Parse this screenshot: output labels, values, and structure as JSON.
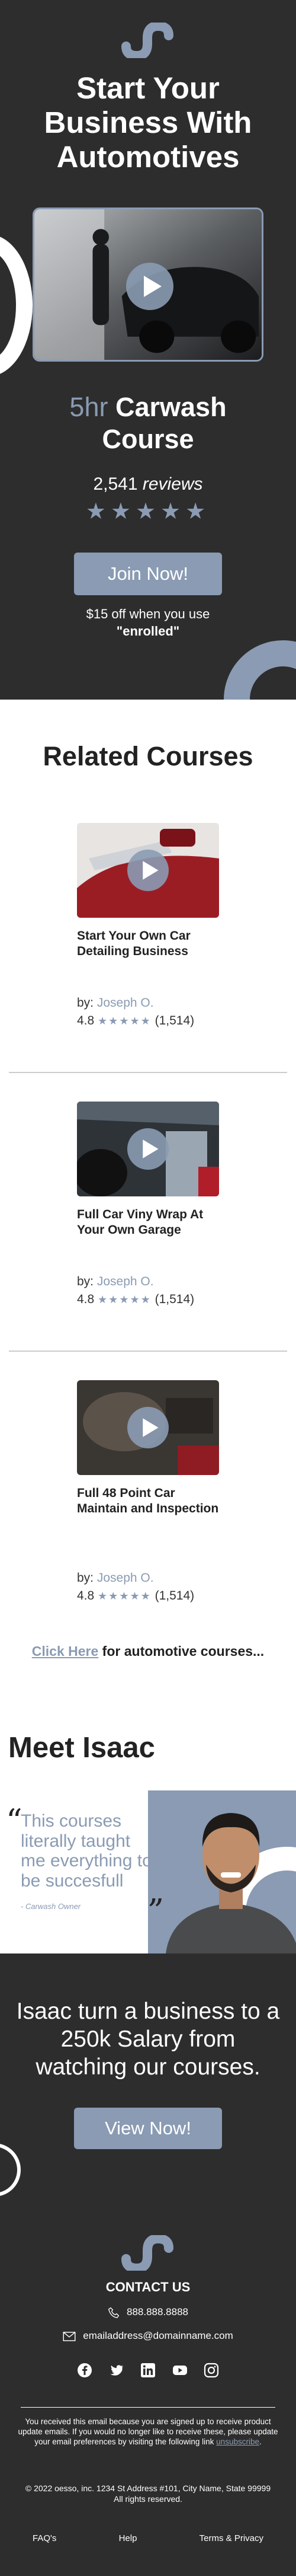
{
  "hero": {
    "title": "Start Your Business With Automotives",
    "course_hours": "5hr",
    "course_name": "Carwash Course",
    "reviews_count": "2,541",
    "reviews_word": "reviews",
    "rating_stars": 5,
    "stars_text": "★★★★★",
    "cta_label": "Join Now!",
    "offer_line1": "$15 off when you use",
    "offer_line2": "\"enrolled\""
  },
  "related": {
    "heading": "Related Courses",
    "by_label": "by:",
    "courses": [
      {
        "title": "Start Your Own Car Detailing Business",
        "author": "Joseph O.",
        "rating": "4.8",
        "stars": "★★★★★",
        "count": "(1,514)"
      },
      {
        "title": "Full Car Viny Wrap At Your Own Garage",
        "author": "Joseph O.",
        "rating": "4.8",
        "stars": "★★★★★",
        "count": "(1,514)"
      },
      {
        "title": "Full 48 Point Car Maintain and Inspection",
        "author": "Joseph O.",
        "rating": "4.8",
        "stars": "★★★★★",
        "count": "(1,514)"
      }
    ],
    "more_link": "Click Here",
    "more_text": " for automotive courses..."
  },
  "meet": {
    "heading": "Meet Isaac",
    "quote": "This courses literally taught me everything to be succesfull",
    "quote_open": "“",
    "quote_close": "„",
    "cite": "- Carwash Owner"
  },
  "testimonial": {
    "text": "Isaac turn a business to a 250k Salary from watching our courses.",
    "cta_label": "View Now!"
  },
  "footer": {
    "contact_heading": "CONTACT US",
    "phone": "888.888.8888",
    "email": "emailaddress@domainname.com",
    "socials": [
      "facebook-icon",
      "twitter-icon",
      "linkedin-icon",
      "youtube-icon",
      "instagram-icon"
    ],
    "disclaimer": "You received this email because you are signed up to receive product update emails. If you would no longer like to receive these, please update your email preferences by visiting the following link ",
    "unsubscribe": "unsubscribe",
    "disclaimer_end": ".",
    "address": "© 2022 oesso, inc. 1234 St Address #101, City Name, State 99999",
    "rights": "All rights reserved.",
    "links": [
      "FAQ's",
      "Help",
      "Terms & Privacy"
    ]
  },
  "colors": {
    "dark_bg": "#2d2d2d",
    "accent": "#8a9bb3",
    "white": "#ffffff"
  }
}
